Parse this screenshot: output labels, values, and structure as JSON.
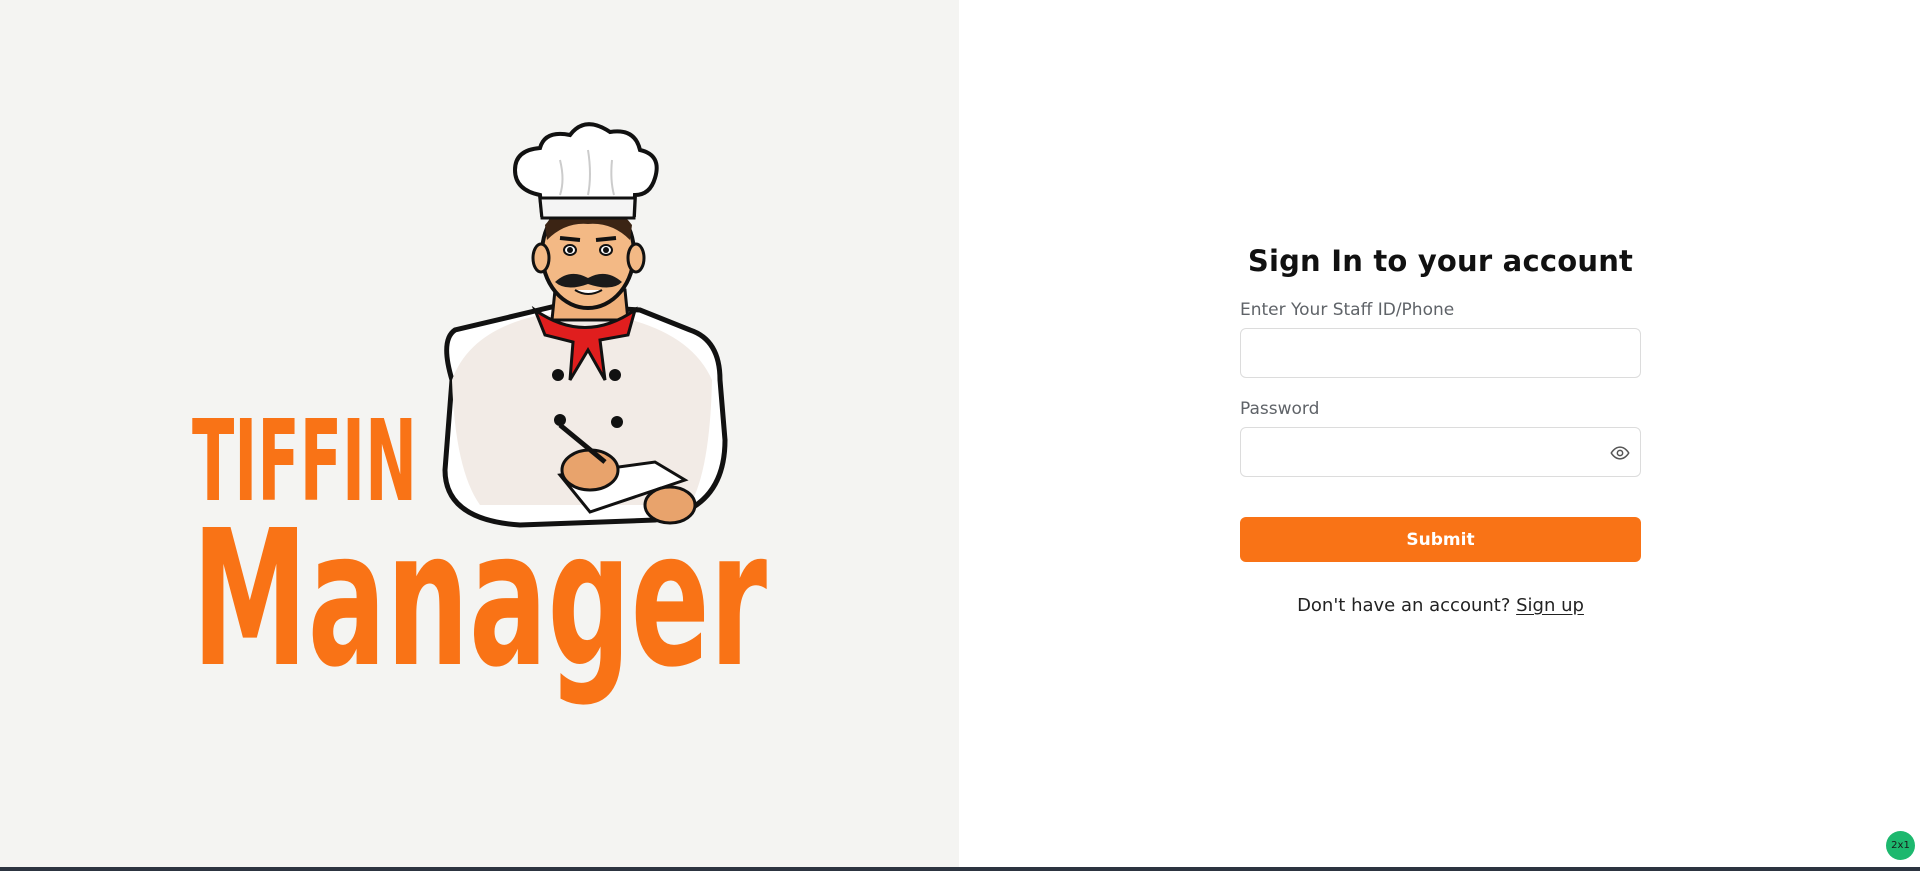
{
  "brand": {
    "logo_line1": "TIFFIN",
    "logo_line2": "Manager",
    "color": "#f97316"
  },
  "login": {
    "title": "Sign In to your account",
    "staff_label": "Enter Your Staff ID/Phone",
    "staff_value": "",
    "password_label": "Password",
    "password_value": "",
    "toggle_icon": "eye-icon",
    "submit_label": "Submit",
    "signup_prompt": "Don't have an account?",
    "signup_link": "Sign up"
  },
  "badge": "2x1",
  "colors": {
    "accent": "#f97316",
    "left_bg": "#f4f4f2",
    "border": "#dcdcdc"
  }
}
